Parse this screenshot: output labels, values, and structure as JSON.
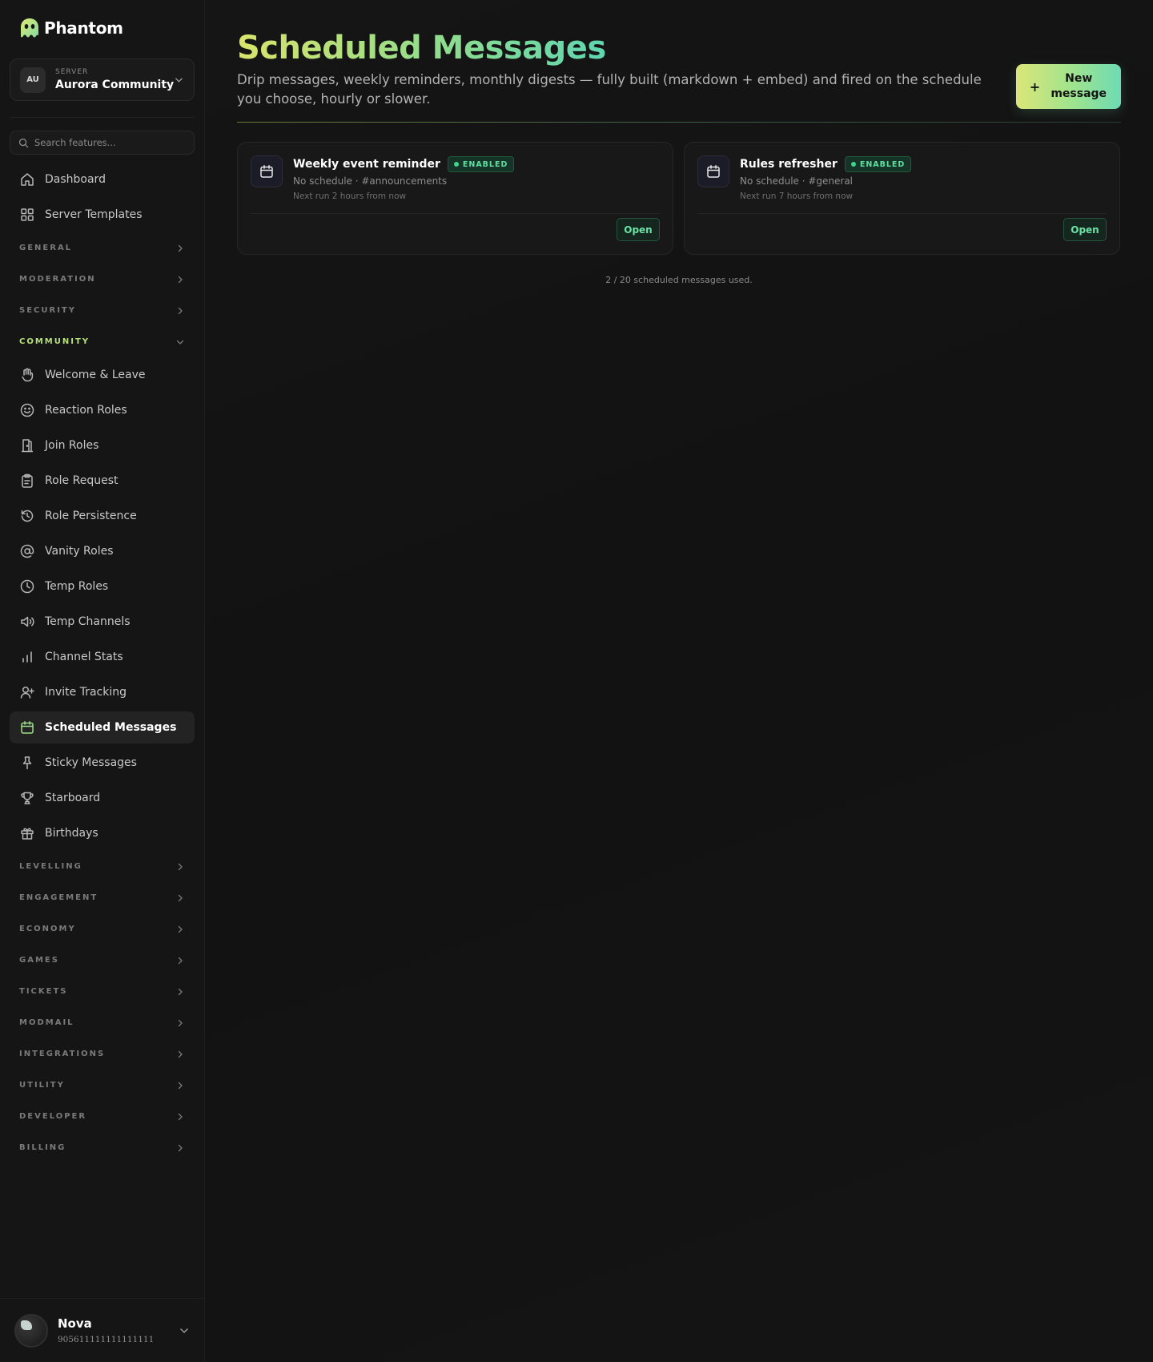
{
  "brand": {
    "name": "Phantom"
  },
  "server": {
    "caption": "SERVER",
    "initials": "AU",
    "name": "Aurora Community"
  },
  "search": {
    "placeholder": "Search features..."
  },
  "nav": {
    "top_items": [
      {
        "label": "Dashboard",
        "icon": "home-icon"
      },
      {
        "label": "Server Templates",
        "icon": "grid-icon"
      }
    ],
    "collapsed_sections_before": [
      "GENERAL",
      "MODERATION",
      "SECURITY"
    ],
    "open_section": "COMMUNITY",
    "community_items": [
      {
        "label": "Welcome & Leave",
        "icon": "hand-icon"
      },
      {
        "label": "Reaction Roles",
        "icon": "smile-icon"
      },
      {
        "label": "Join Roles",
        "icon": "door-icon"
      },
      {
        "label": "Role Request",
        "icon": "clipboard-icon"
      },
      {
        "label": "Role Persistence",
        "icon": "history-icon"
      },
      {
        "label": "Vanity Roles",
        "icon": "at-icon"
      },
      {
        "label": "Temp Roles",
        "icon": "clock-icon"
      },
      {
        "label": "Temp Channels",
        "icon": "speaker-icon"
      },
      {
        "label": "Channel Stats",
        "icon": "bar-chart-icon"
      },
      {
        "label": "Invite Tracking",
        "icon": "user-plus-icon"
      },
      {
        "label": "Scheduled Messages",
        "icon": "calendar-icon",
        "active": true
      },
      {
        "label": "Sticky Messages",
        "icon": "pin-icon"
      },
      {
        "label": "Starboard",
        "icon": "trophy-icon"
      },
      {
        "label": "Birthdays",
        "icon": "gift-icon"
      }
    ],
    "collapsed_sections_after": [
      "LEVELLING",
      "ENGAGEMENT",
      "ECONOMY",
      "GAMES",
      "TICKETS",
      "MODMAIL",
      "INTEGRATIONS",
      "UTILITY",
      "DEVELOPER",
      "BILLING"
    ]
  },
  "user": {
    "name": "Nova",
    "id": "905611111111111111"
  },
  "page": {
    "title": "Scheduled Messages",
    "description": "Drip messages, weekly reminders, monthly digests — fully built (markdown + embed) and fired on the schedule you choose, hourly or slower.",
    "new_button": {
      "plus": "+",
      "label": "New message"
    }
  },
  "cards": [
    {
      "title": "Weekly event reminder",
      "status": "ENABLED",
      "meta": "No schedule · #announcements",
      "next_run": "Next run 2 hours from now",
      "action": "Open"
    },
    {
      "title": "Rules refresher",
      "status": "ENABLED",
      "meta": "No schedule · #general",
      "next_run": "Next run 7 hours from now",
      "action": "Open"
    }
  ],
  "usage": "2 / 20 scheduled messages used.",
  "colors": {
    "accent_start": "#d9e46a",
    "accent_end": "#5fd6b0",
    "status_green": "#3ed68a",
    "background": "#121212"
  }
}
